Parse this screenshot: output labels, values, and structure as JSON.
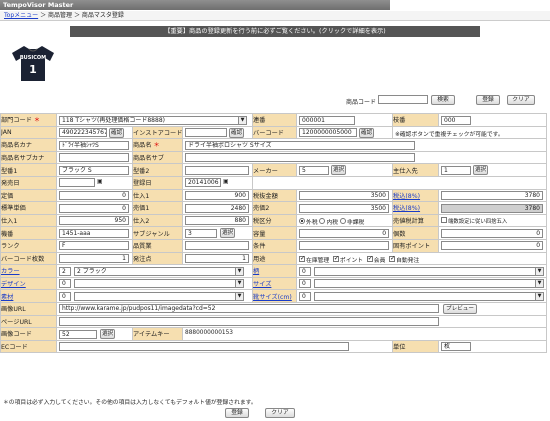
{
  "app_title": "TempoVisor Master",
  "breadcrumb": {
    "top": "Topメニュー",
    "sep1": "＞",
    "mid": "商品管理",
    "sep2": "＞",
    "current": "商品マスタ登録"
  },
  "notice": "【重要】商品の登録更新を行う前に必ずご覧ください。(クリックで詳細を表示)",
  "shirt": {
    "brand": "BUSICOM",
    "number": "1"
  },
  "code_search": {
    "label": "商品コード",
    "value": "",
    "search_btn": "検索",
    "register_btn": "登録",
    "clear_btn": "クリア"
  },
  "fields": {
    "dept_label": "部門コード",
    "dept_value": "118 Tシャツ(再处理価格コード8888)",
    "serial_label": "連番",
    "serial_value": "000001",
    "branch_label": "枝番",
    "branch_value": "000",
    "jan_label": "JAN",
    "jan_value": "4902223457671",
    "confirm": "確認",
    "instore_label": "インストアコード",
    "barcode_label": "バーコード",
    "barcode_value": "1200000005000",
    "barcode_note": "※確認ボタンで重複チェックが可能です。",
    "kana_label": "商品名カナ",
    "kana_value": "ﾄﾞﾗｲ半袖ｼｬﾂS",
    "name_label": "商品名",
    "name_value": "ドライ半袖ポロシャツ Sサイズ",
    "kana_sub_label": "商品名サブカナ",
    "name_sub_label": "商品名サブ",
    "type1_label": "型番1",
    "type1_value": "ブラック S",
    "type2_label": "型番2",
    "maker_label": "メーカー",
    "maker_value": "5",
    "select": "選択",
    "supplier_label": "主仕入先",
    "supplier_value": "1",
    "release_label": "発売日",
    "register_label": "登録日",
    "register_value": "20141006",
    "list_price_label": "定価",
    "list_price_value": "0",
    "cost_tax_out_label": "仕入1",
    "cost_tax_out_value": "900",
    "tax_in_total_label": "税抜金額",
    "tax_in_total_value": "3500",
    "tax_incl_label": "税込(8%)",
    "tax_incl_value": "3780",
    "std_price_label": "標準単価",
    "std_price_value": "0",
    "price1_label": "売価1",
    "price1_value": "2480",
    "price2_label": "売価2",
    "price2_value": "3500",
    "tax_incl2_label": "税込(8%)",
    "tax_incl2_value": "3780",
    "cost1_label": "仕入1",
    "cost1_value": "950",
    "cost2_label": "仕入2",
    "cost2_value": "880",
    "tax_class_label": "税区分",
    "tax_opt_out": "外税",
    "tax_opt_in": "内税",
    "tax_opt_none": "非課税",
    "sales_tax_label": "売値税計算",
    "sales_tax_opt": "端数設定に従い四捨五入",
    "model_label": "機番",
    "model_value": "1451-aaa",
    "subgenre_label": "サブジャンル",
    "subgenre_value": "3",
    "capacity_label": "容量",
    "capacity_value": "0",
    "count_label": "個数",
    "count_value": "0",
    "rank_label": "ランク",
    "rank_value": "F",
    "quality_label": "品質業",
    "condition_label": "条件",
    "condition_value": "",
    "point_label": "固有ポイント",
    "point_value": "0",
    "barcode_issue_label": "バーコード枚数",
    "barcode_issue_value": "1",
    "origin_label": "発注点",
    "origin_value": "1",
    "usage_label": "用途",
    "usage_opt1": "在庫管理",
    "usage_opt2": "ポイント",
    "usage_opt3": "会員",
    "usage_opt4": "自動発注",
    "color_label": "カラー",
    "color_code": "2",
    "color_value": "2 ブラック",
    "size_label": "柄",
    "size_value": "0",
    "design_label": "デザイン",
    "design_code": "0",
    "size2_label": "サイズ",
    "size2_value": "0",
    "material_label": "素材",
    "material_code": "0",
    "size_cat_label": "靴サイズ(cm)",
    "size_cat_value": "0",
    "image_url_label": "画像URL",
    "image_url_value": "http://www.karame.jp/pudpos11/imagedata?cd=52",
    "preview_btn": "プレビュー",
    "page_url_label": "ページURL",
    "image_code_label": "画像コード",
    "image_code_value": "52",
    "item_key_label": "アイテムキー",
    "item_key_value": "8880000000153",
    "ec_code_label": "ECコード",
    "unit_label": "単位",
    "unit_value": "枚"
  },
  "footer": {
    "note": "＊の項目は必ず入力してください。その他の項目は入力しなくてもデフォルト値が登録されます。",
    "register_btn": "登録",
    "clear_btn": "クリア"
  },
  "colors": {
    "label_bg": "#f6dfb0",
    "notice_bg": "#555555",
    "link": "#1a3cc8"
  }
}
